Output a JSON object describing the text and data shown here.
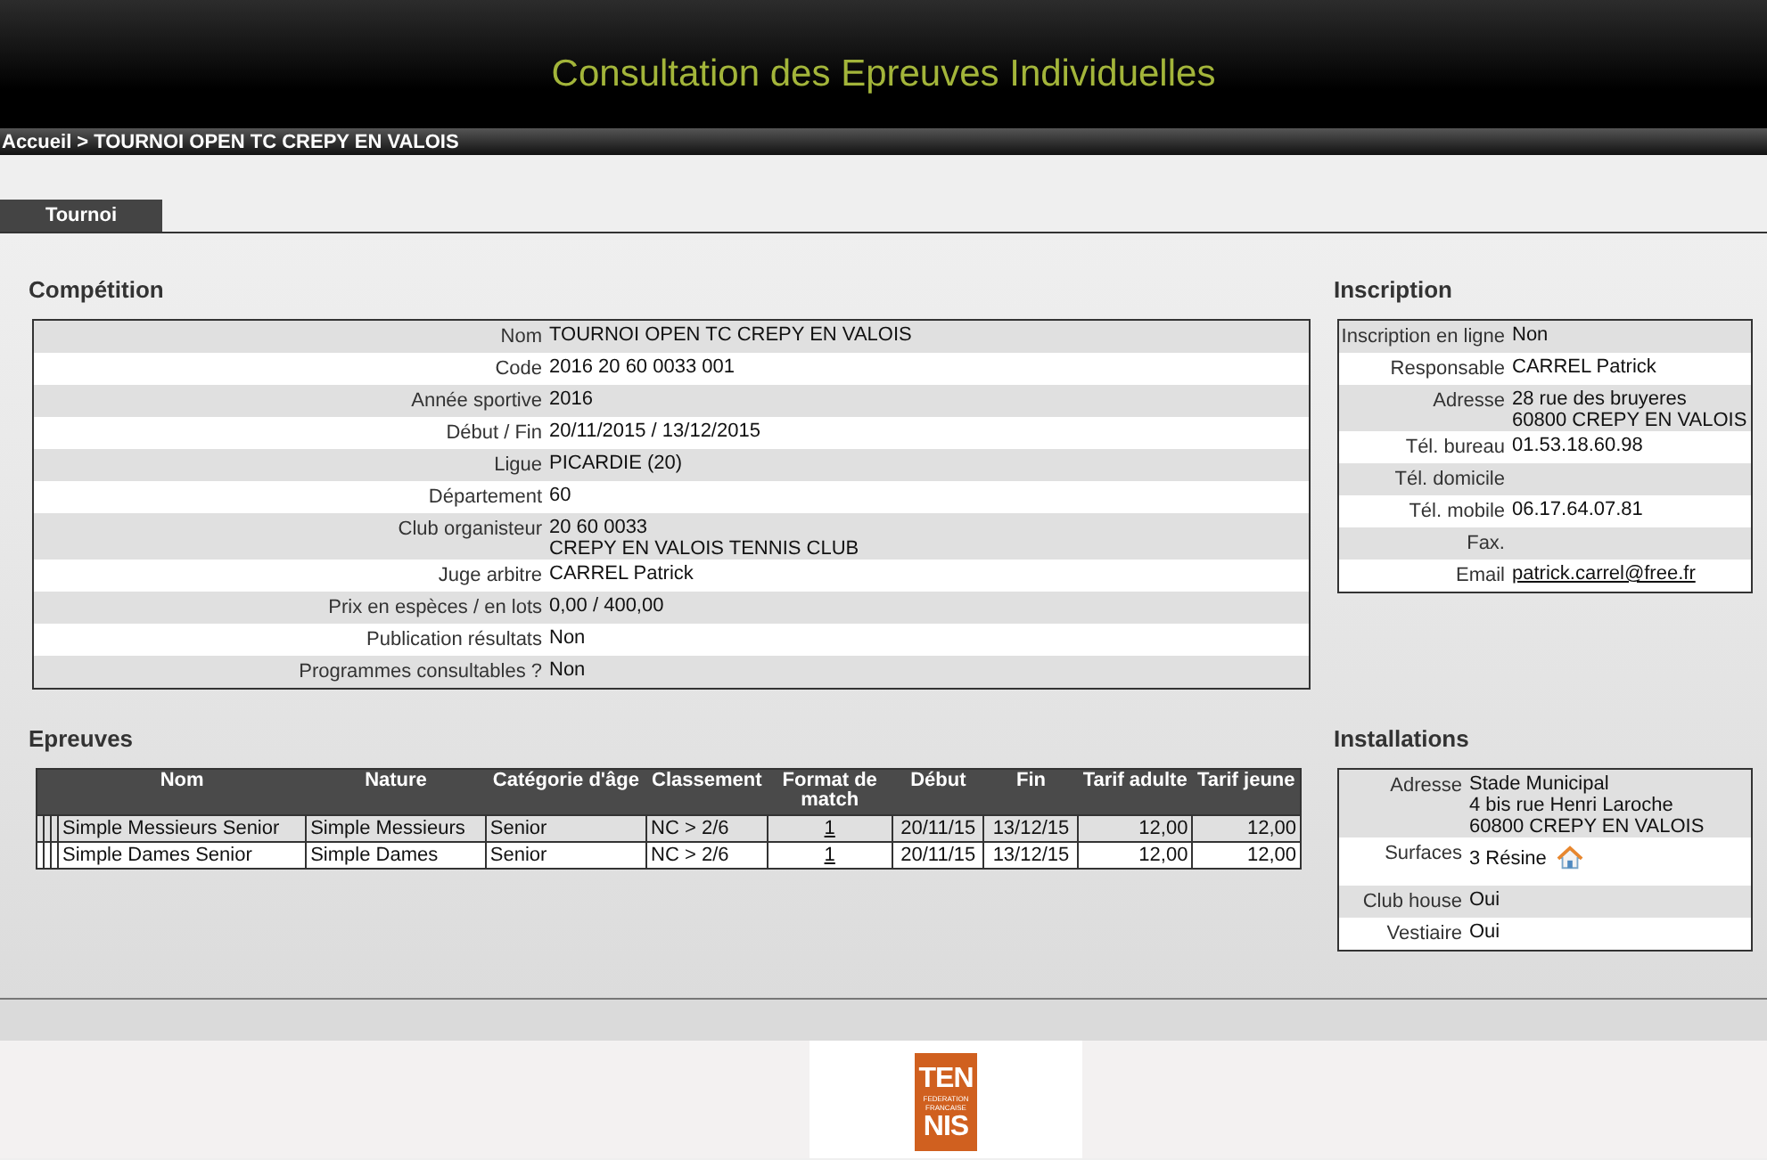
{
  "header": {
    "title": "Consultation des Epreuves Individuelles"
  },
  "breadcrumb": {
    "items": [
      "Accueil",
      "TOURNOI OPEN TC CREPY EN VALOIS"
    ],
    "separator": ">"
  },
  "tabs": [
    {
      "label": "Tournoi",
      "selected": true
    }
  ],
  "competition": {
    "title": "Compétition",
    "rows": [
      {
        "label": "Nom",
        "lines": [
          "TOURNOI OPEN TC CREPY EN VALOIS"
        ]
      },
      {
        "label": "Code",
        "lines": [
          "2016 20 60 0033 001"
        ]
      },
      {
        "label": "Année sportive",
        "lines": [
          "2016"
        ]
      },
      {
        "label": "Début / Fin",
        "lines": [
          "20/11/2015 / 13/12/2015"
        ]
      },
      {
        "label": "Ligue",
        "lines": [
          "PICARDIE (20)"
        ]
      },
      {
        "label": "Département",
        "lines": [
          "60"
        ]
      },
      {
        "label": "Club organisteur",
        "lines": [
          "20 60 0033",
          "CREPY EN VALOIS TENNIS CLUB"
        ]
      },
      {
        "label": "Juge arbitre",
        "lines": [
          "CARREL Patrick"
        ]
      },
      {
        "label": "Prix en espèces / en lots",
        "lines": [
          "0,00 / 400,00"
        ]
      },
      {
        "label": "Publication résultats",
        "lines": [
          "Non"
        ]
      },
      {
        "label": "Programmes consultables ?",
        "lines": [
          "Non"
        ]
      }
    ]
  },
  "inscription": {
    "title": "Inscription",
    "rows": [
      {
        "label": "Inscription en ligne",
        "kind": "text",
        "lines": [
          "Non"
        ]
      },
      {
        "label": "Responsable",
        "kind": "text",
        "lines": [
          "CARREL Patrick"
        ]
      },
      {
        "label": "Adresse",
        "kind": "text",
        "lines": [
          "28 rue des bruyeres",
          "60800 CREPY EN VALOIS"
        ]
      },
      {
        "label": "Tél. bureau",
        "kind": "text",
        "lines": [
          "01.53.18.60.98"
        ]
      },
      {
        "label": "Tél. domicile"
      },
      {
        "label": "Tél. mobile",
        "kind": "text",
        "lines": [
          "06.17.64.07.81"
        ]
      },
      {
        "label": "Fax."
      },
      {
        "label": "Email",
        "kind": "link",
        "lines": [
          "patrick.carrel@free.fr"
        ]
      }
    ]
  },
  "epreuves": {
    "title": "Epreuves",
    "columns": [
      "Nom",
      "Nature",
      "Catégorie d'âge",
      "Classement",
      "Format de match",
      "Début",
      "Fin",
      "Tarif adulte",
      "Tarif jeune"
    ],
    "rows": [
      {
        "nom": "Simple Messieurs Senior",
        "nature": "Simple Messieurs",
        "categorie": "Senior",
        "classement": "NC > 2/6",
        "format": "1",
        "debut": "20/11/15",
        "fin": "13/12/15",
        "tarif_adulte": "12,00",
        "tarif_jeune": "12,00"
      },
      {
        "nom": "Simple Dames Senior",
        "nature": "Simple Dames",
        "categorie": "Senior",
        "classement": "NC > 2/6",
        "format": "1",
        "debut": "20/11/15",
        "fin": "13/12/15",
        "tarif_adulte": "12,00",
        "tarif_jeune": "12,00"
      }
    ]
  },
  "installations": {
    "title": "Installations",
    "rows": [
      {
        "label": "Adresse",
        "kind": "text",
        "lines": [
          "Stade Municipal",
          "4 bis rue Henri Laroche",
          "60800 CREPY EN VALOIS"
        ]
      },
      {
        "label": "Surfaces",
        "kind": "surface",
        "lines": [
          "3 Résine"
        ]
      },
      {
        "label": "Club house",
        "kind": "text",
        "lines": [
          "Oui"
        ]
      },
      {
        "label": "Vestiaire",
        "kind": "text",
        "lines": [
          "Oui"
        ]
      }
    ]
  },
  "footer": {
    "logo": {
      "top": "TEN",
      "middle": [
        "FEDERATION",
        "FRANCAISE"
      ],
      "bottom": "NIS"
    }
  }
}
